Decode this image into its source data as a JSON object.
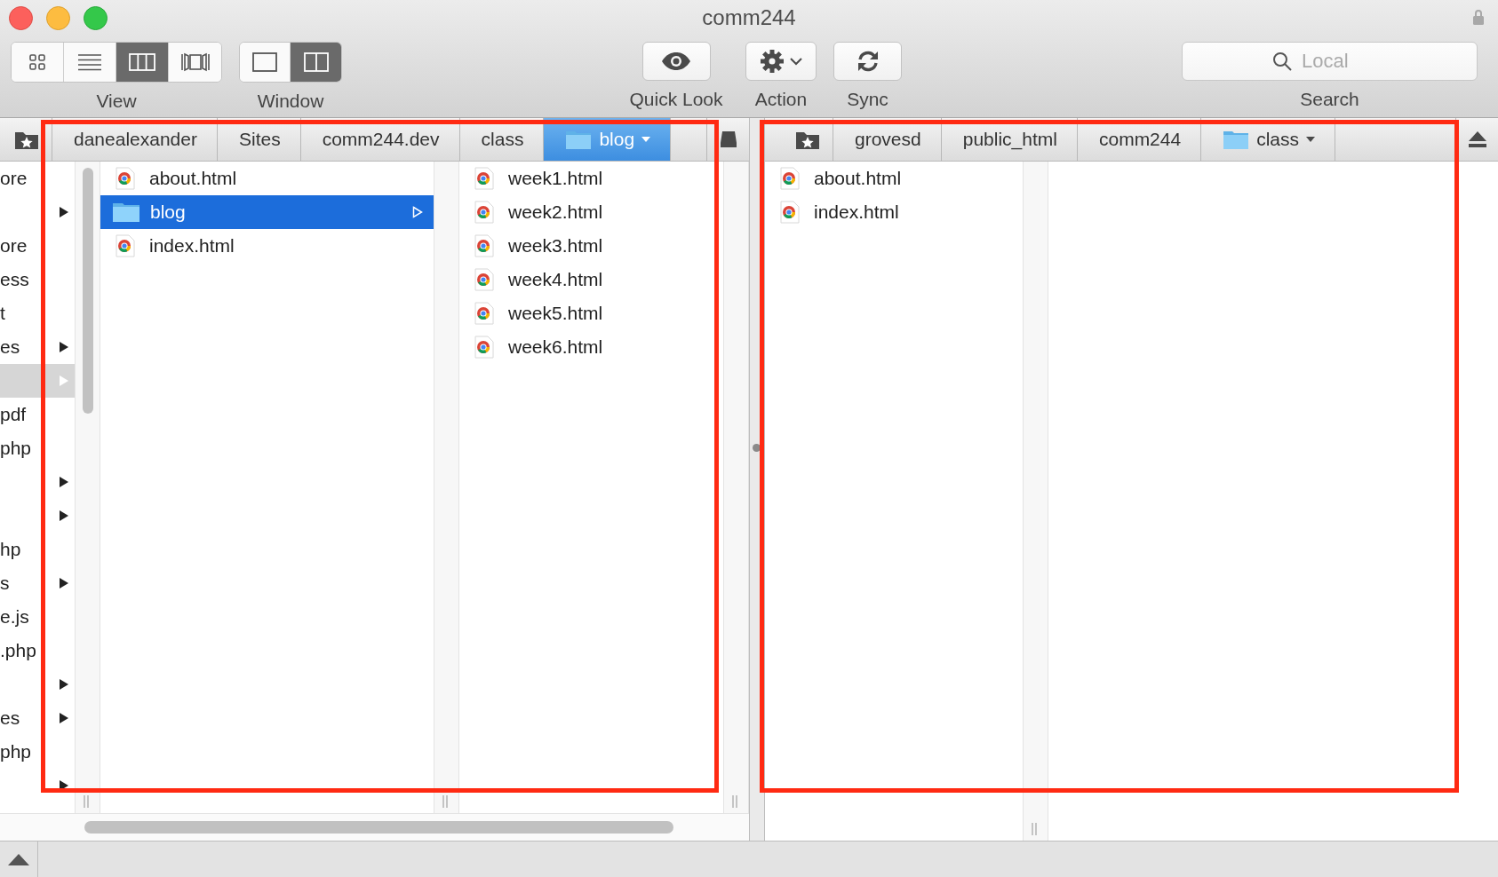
{
  "window": {
    "title": "comm244"
  },
  "toolbar": {
    "view": {
      "label": "View",
      "modes": [
        {
          "kind": "icons",
          "selected": false
        },
        {
          "kind": "list",
          "selected": false
        },
        {
          "kind": "columns",
          "selected": true
        },
        {
          "kind": "coverflow",
          "selected": false
        }
      ]
    },
    "window": {
      "label": "Window",
      "modes": [
        {
          "kind": "single",
          "selected": false
        },
        {
          "kind": "dual",
          "selected": true
        }
      ]
    },
    "buttons": [
      {
        "kind": "quicklook",
        "label": "Quick Look"
      },
      {
        "kind": "action",
        "label": "Action"
      },
      {
        "kind": "sync",
        "label": "Sync"
      }
    ],
    "search": {
      "placeholder": "Local",
      "label": "Search"
    }
  },
  "left_pane": {
    "highlighted": true,
    "path": [
      {
        "label": "danealexander",
        "kind": "plain",
        "selected": false
      },
      {
        "label": "Sites",
        "kind": "plain",
        "selected": false
      },
      {
        "label": "comm244.dev",
        "kind": "plain",
        "selected": false
      },
      {
        "label": "class",
        "kind": "plain",
        "selected": false
      },
      {
        "label": "blog",
        "kind": "folder",
        "selected": true
      }
    ],
    "columns": [
      {
        "active": false,
        "items": [
          {
            "name": "ore",
            "expandable": false,
            "selected": false
          },
          {
            "expandable": true,
            "selected": false
          },
          {
            "name": "ore",
            "expandable": false,
            "selected": false
          },
          {
            "name": "ess",
            "expandable": false,
            "selected": false
          },
          {
            "name": "t",
            "expandable": false,
            "selected": false
          },
          {
            "name": "es",
            "expandable": true,
            "selected": false
          },
          {
            "expandable": true,
            "selected": true
          },
          {
            "name": "pdf",
            "expandable": false,
            "selected": false
          },
          {
            "name": "php",
            "expandable": false,
            "selected": false
          },
          {
            "expandable": true,
            "selected": false
          },
          {
            "expandable": true,
            "selected": false
          },
          {
            "name": "hp",
            "expandable": false,
            "selected": false
          },
          {
            "name": "s",
            "expandable": true,
            "selected": false
          },
          {
            "name": "e.js",
            "expandable": false,
            "selected": false
          },
          {
            "name": ".php",
            "expandable": false,
            "selected": false
          },
          {
            "expandable": true,
            "selected": false
          },
          {
            "name": "es",
            "expandable": true,
            "selected": false
          },
          {
            "name": "php",
            "expandable": false,
            "selected": false
          },
          {
            "expandable": true,
            "selected": false
          }
        ]
      },
      {
        "active": true,
        "items": [
          {
            "name": "about.html",
            "kind": "html",
            "expandable": false,
            "selected": false
          },
          {
            "name": "blog",
            "kind": "folder",
            "expandable": true,
            "selected": true
          },
          {
            "name": "index.html",
            "kind": "html",
            "expandable": false,
            "selected": false
          }
        ]
      },
      {
        "items": [
          {
            "name": "week1.html",
            "kind": "html",
            "expandable": false,
            "selected": false
          },
          {
            "name": "week2.html",
            "kind": "html",
            "expandable": false,
            "selected": false
          },
          {
            "name": "week3.html",
            "kind": "html",
            "expandable": false,
            "selected": false
          },
          {
            "name": "week4.html",
            "kind": "html",
            "expandable": false,
            "selected": false
          },
          {
            "name": "week5.html",
            "kind": "html",
            "expandable": false,
            "selected": false
          },
          {
            "name": "week6.html",
            "kind": "html",
            "expandable": false,
            "selected": false
          }
        ]
      }
    ]
  },
  "right_pane": {
    "highlighted": true,
    "path": [
      {
        "label": "grovesd",
        "kind": "plain",
        "selected": false
      },
      {
        "label": "public_html",
        "kind": "plain",
        "selected": false
      },
      {
        "label": "comm244",
        "kind": "plain",
        "selected": false
      },
      {
        "label": "class",
        "kind": "folder",
        "selected": false
      }
    ],
    "columns": [
      {
        "items": [
          {
            "name": "about.html",
            "kind": "html",
            "expandable": false,
            "selected": false
          },
          {
            "name": "index.html",
            "kind": "html",
            "expandable": false,
            "selected": false
          }
        ]
      }
    ]
  }
}
